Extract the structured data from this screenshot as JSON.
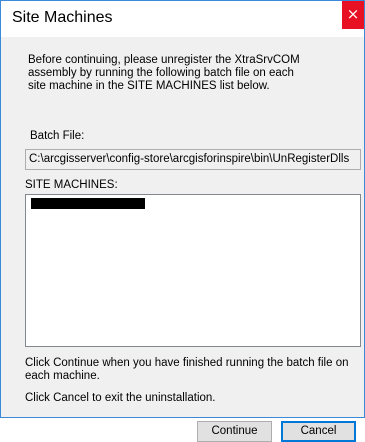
{
  "window": {
    "title": "Site Machines",
    "close_glyph": "×"
  },
  "dialog": {
    "intro_text": "Before continuing, please unregister the XtraSrvCOM\nassembly by running the following batch file on each\nsite machine in the SITE MACHINES list below.",
    "batch_label": "Batch File:",
    "batch_value": "C:\\arcgisserver\\config-store\\arcgisforinspire\\bin\\UnRegisterDlls",
    "machines_label": "SITE MACHINES:",
    "continue_instruction": "Click Continue when you have finished running the batch file on each machine.",
    "cancel_instruction": "Click Cancel to exit the uninstallation.",
    "continue_label": "Continue",
    "cancel_label": "Cancel"
  },
  "colors": {
    "close_button": "#e81123",
    "window_border": "#3b8ad9",
    "default_button_border": "#0078d7"
  }
}
